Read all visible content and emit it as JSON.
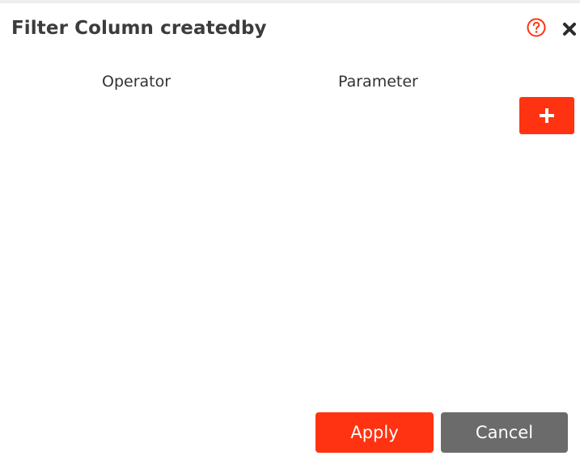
{
  "dialog": {
    "title": "Filter Column createdby",
    "icons": {
      "help": "question-circle-icon",
      "close": "close-x-icon"
    }
  },
  "columns": {
    "operator": "Operator",
    "parameter": "Parameter"
  },
  "add_button": {
    "icon": "plus-icon"
  },
  "footer": {
    "apply_label": "Apply",
    "cancel_label": "Cancel"
  },
  "colors": {
    "accent": "#ff3311",
    "secondary_button": "#6b6b6b",
    "title_text": "#3c3c3c"
  }
}
